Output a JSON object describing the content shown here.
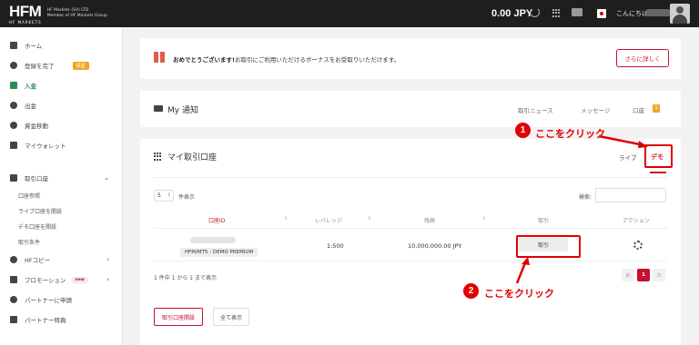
{
  "header": {
    "logo": "HFM",
    "logo_sub": "HF MARKETS",
    "company_line1": "HF Markets (SV) LTD",
    "company_line2": "Member of HF Markets Group",
    "balance": "0.00 JPY",
    "greeting": "こんにちは"
  },
  "sidebar": {
    "items": [
      {
        "label": "ホーム",
        "icon": "chart-icon"
      },
      {
        "label": "登録を完了",
        "icon": "gear-icon",
        "badge": "保留"
      },
      {
        "label": "入金",
        "icon": "deposit-icon"
      },
      {
        "label": "出金",
        "icon": "withdraw-icon"
      },
      {
        "label": "資金移動",
        "icon": "transfer-icon"
      },
      {
        "label": "マイウォレット",
        "icon": "wallet-icon"
      },
      {
        "label": "取引口座",
        "icon": "accounts-icon"
      },
      {
        "label": "HFコピー",
        "icon": "copy-icon"
      },
      {
        "label": "プロモーション",
        "icon": "promo-icon",
        "badge": "new"
      },
      {
        "label": "パートナーに申請",
        "icon": "partner-icon"
      },
      {
        "label": "パートナー特典",
        "icon": "benefit-icon"
      }
    ],
    "sub_items": [
      "口座参照",
      "ライブ口座を開設",
      "デモ口座を開設",
      "取引条件"
    ]
  },
  "bonus": {
    "bold": "おめでとうございます!",
    "text": "お取引にご利用いただけるボーナスをお受取りいただけます。",
    "button": "さらに詳しく"
  },
  "notices": {
    "title": "My 通知",
    "tabs": [
      "取引ニュース",
      "メッセージ",
      "口座"
    ],
    "badge": "1"
  },
  "accounts": {
    "title": "マイ取引口座",
    "tab_live": "ライブ",
    "tab_demo": "デモ",
    "page_size": "5",
    "page_size_label": "件表示",
    "search_label": "検索:",
    "columns": [
      "口座ID",
      "レバレッジ",
      "残高",
      "取引",
      "アクション"
    ],
    "row": {
      "account_type": "HFM/MT5 - DEMO PREMIUM",
      "leverage": "1:500",
      "balance": "10,000,000.00 JPY",
      "trade_button": "取引"
    },
    "pager_info": "1 件中 1 から 1 まで表示",
    "pager": {
      "prev": "前",
      "current": "1",
      "next": "次"
    },
    "open_button": "取引口座開設",
    "show_all_button": "全て表示"
  },
  "annotations": {
    "step1_num": "1",
    "step1_text": "ここをクリック",
    "step2_num": "2",
    "step2_text": "ここをクリック",
    "color": "#e10000"
  },
  "colors": {
    "brand_red": "#c8102e",
    "active_green": "#2e8b57",
    "badge_orange": "#f5a623"
  }
}
